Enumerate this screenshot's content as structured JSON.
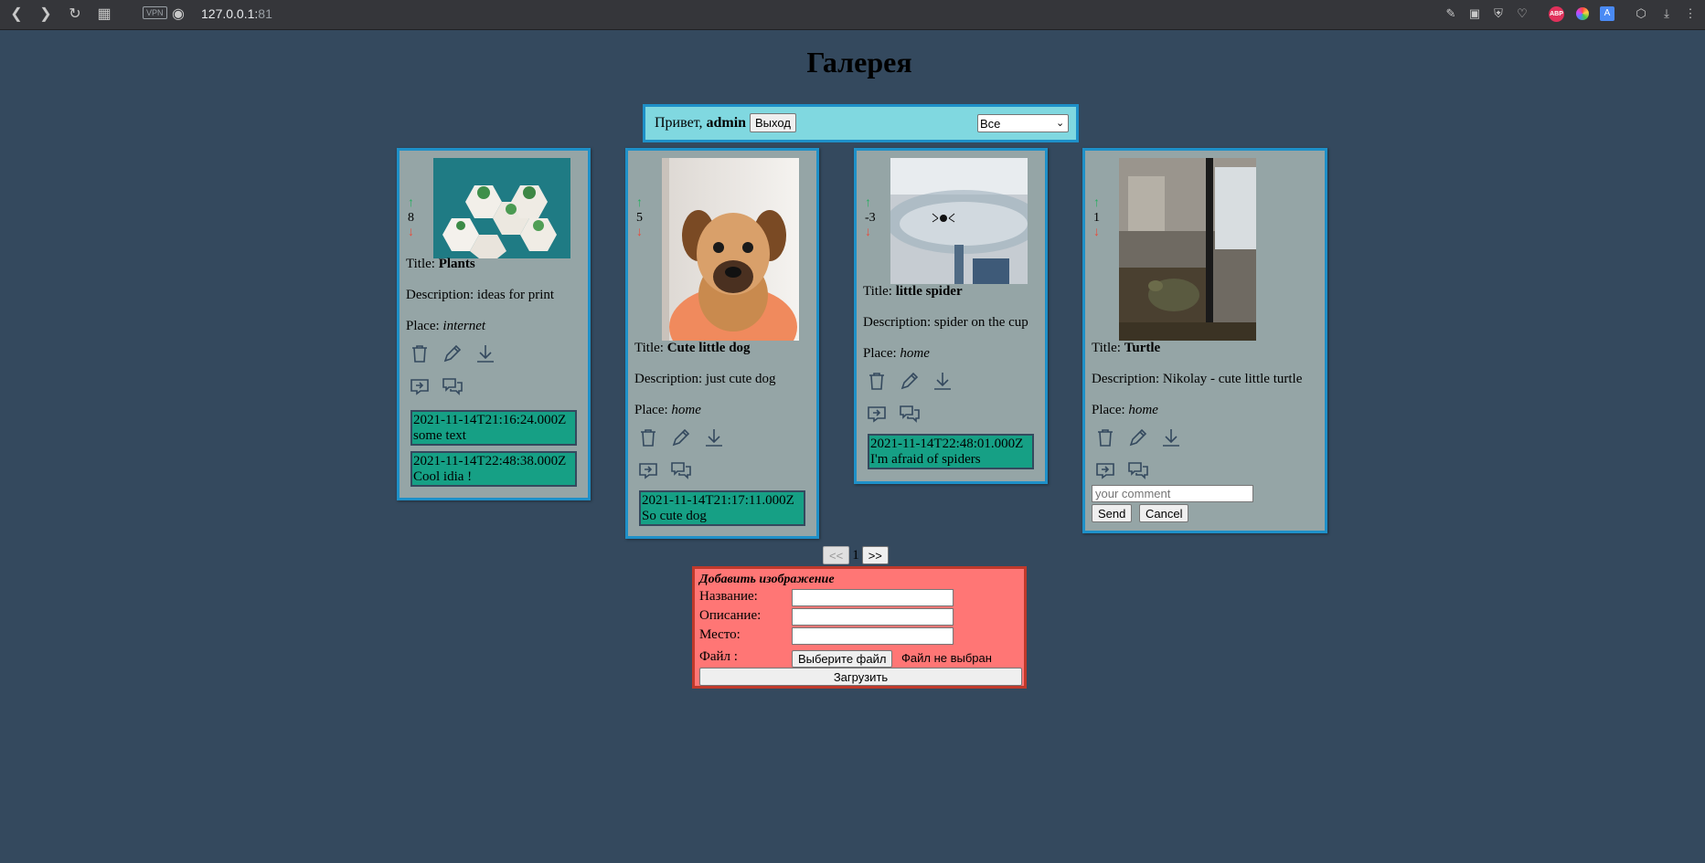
{
  "browser": {
    "url_host": "127.0.0.1:",
    "url_port": "81",
    "vpn_label": "VPN",
    "abp_label": "ABP",
    "translate_label": "A"
  },
  "page": {
    "title": "Галерея"
  },
  "userbar": {
    "greeting": "Привет,",
    "username": "admin",
    "logout_label": "Выход",
    "filter_selected": "Все"
  },
  "cards": [
    {
      "rating": "8",
      "title_label": "Title:",
      "title": "Plants",
      "description_label": "Description:",
      "description": "ideas for print",
      "place_label": "Place:",
      "place": "internet",
      "comments": [
        {
          "date": "2021-11-14T21:16:24.000Z",
          "text": "some text"
        },
        {
          "date": "2021-11-14T22:48:38.000Z",
          "text": "Cool idia !"
        }
      ]
    },
    {
      "rating": "5",
      "title_label": "Title:",
      "title": "Cute little dog",
      "description_label": "Description:",
      "description": "just cute dog",
      "place_label": "Place:",
      "place": "home",
      "comments": [
        {
          "date": "2021-11-14T21:17:11.000Z",
          "text": "So cute dog"
        }
      ]
    },
    {
      "rating": "-3",
      "title_label": "Title:",
      "title": "little spider",
      "description_label": "Description:",
      "description": "spider on the cup",
      "place_label": "Place:",
      "place": "home",
      "comments": [
        {
          "date": "2021-11-14T22:48:01.000Z",
          "text": "I'm afraid of spiders"
        }
      ]
    },
    {
      "rating": "1",
      "title_label": "Title:",
      "title": "Turtle",
      "description_label": "Description:",
      "description": "Nikolay - cute little turtle",
      "place_label": "Place:",
      "place": "home",
      "comment_placeholder": "your comment",
      "send_label": "Send",
      "cancel_label": "Cancel"
    }
  ],
  "vote_up": "↑",
  "vote_down": "↓",
  "pager": {
    "prev": "<<",
    "page": "1",
    "next": ">>"
  },
  "add_form": {
    "title": "Добавить изображение",
    "name_label": "Название:",
    "description_label": "Описание:",
    "place_label": "Место:",
    "file_label": "Файл :",
    "file_button": "Выберите файл",
    "file_status": "Файл не выбран",
    "submit_label": "Загрузить"
  }
}
